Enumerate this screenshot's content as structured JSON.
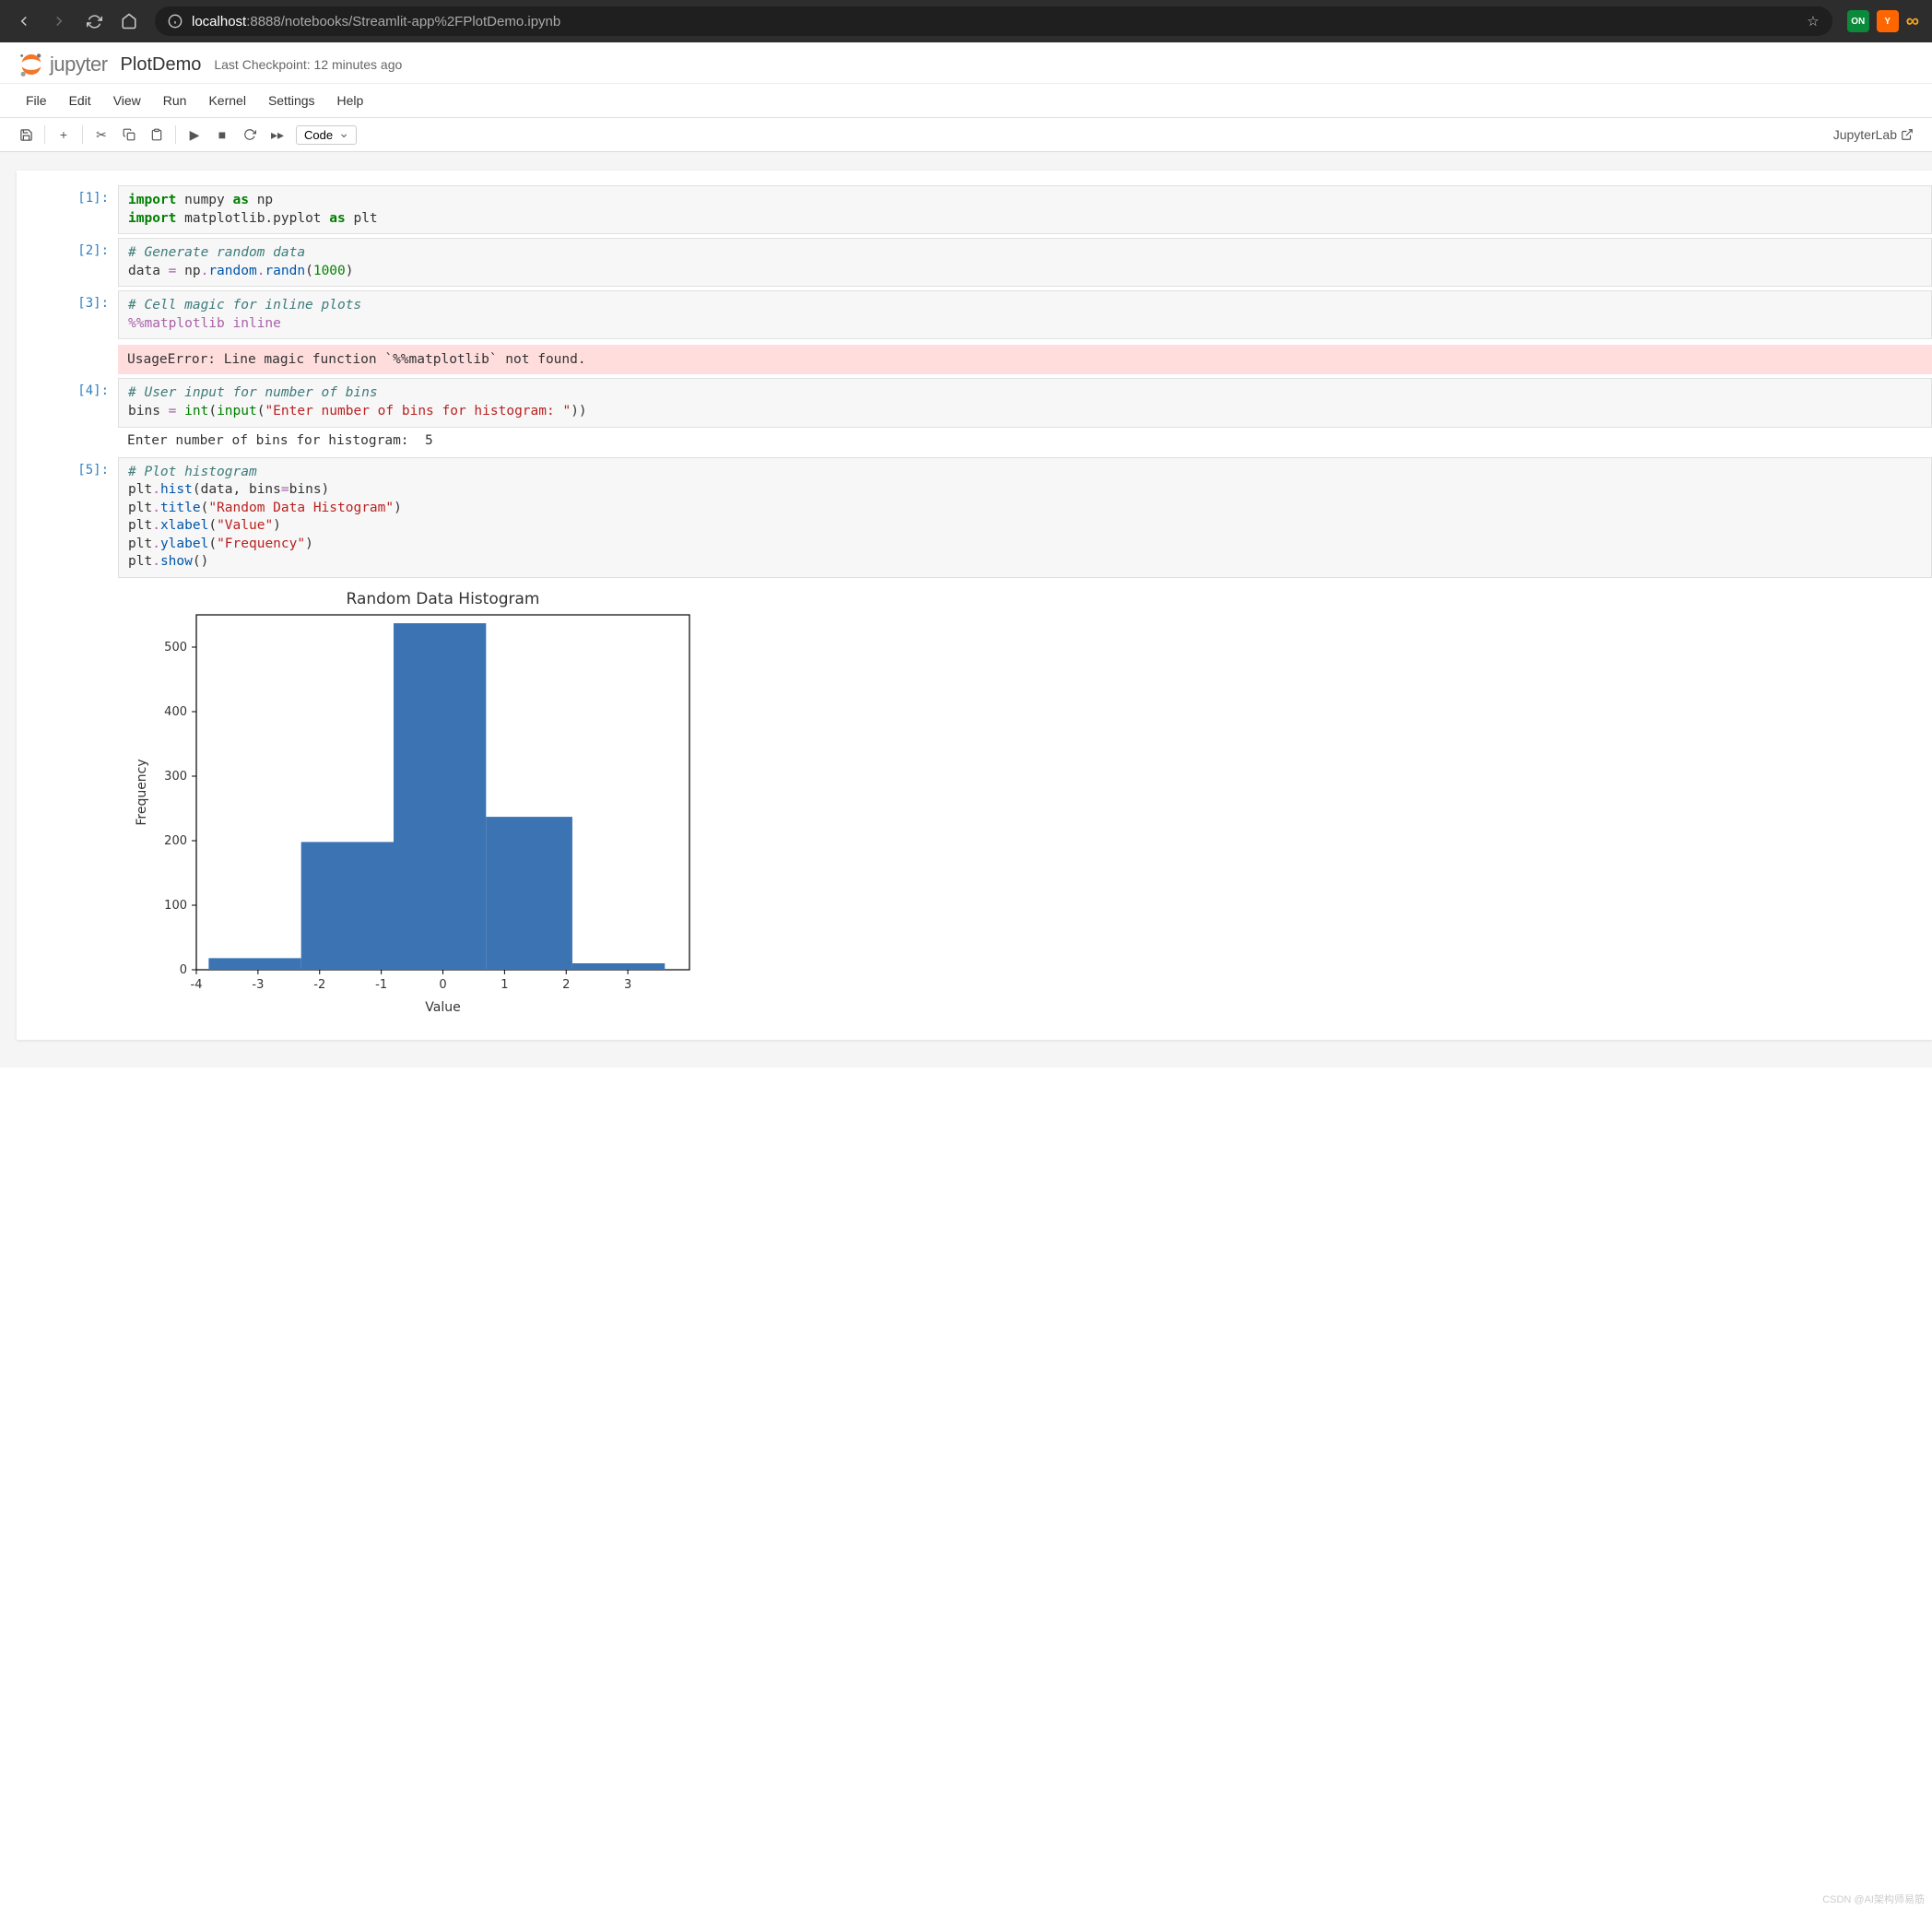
{
  "browser": {
    "url_host": "localhost",
    "url_port_path": ":8888/notebooks/Streamlit-app%2FPlotDemo.ipynb",
    "ext_on": "ON",
    "ext_y": "Y"
  },
  "header": {
    "brand": "jupyter",
    "title": "PlotDemo",
    "checkpoint": "Last Checkpoint: 12 minutes ago"
  },
  "menu": [
    "File",
    "Edit",
    "View",
    "Run",
    "Kernel",
    "Settings",
    "Help"
  ],
  "toolbar": {
    "celltype": "Code",
    "jl_link": "JupyterLab"
  },
  "cells": {
    "c1": {
      "prompt": "[1]:"
    },
    "c2": {
      "prompt": "[2]:"
    },
    "c3": {
      "prompt": "[3]:",
      "error": "UsageError: Line magic function `%%matplotlib` not found."
    },
    "c4": {
      "prompt": "[4]:",
      "output": "Enter number of bins for histogram:  5"
    },
    "c5": {
      "prompt": "[5]:"
    }
  },
  "code": {
    "c1_l1_kw1": "import",
    "c1_l1_name": " numpy ",
    "c1_l1_kw2": "as",
    "c1_l1_alias": " np",
    "c1_l2_kw1": "import",
    "c1_l2_name": " matplotlib.pyplot ",
    "c1_l2_kw2": "as",
    "c1_l2_alias": " plt",
    "c2_l1": "# Generate random data",
    "c2_l2_a": "data ",
    "c2_l2_op": "=",
    "c2_l2_b": " np",
    "c2_l2_d1": ".",
    "c2_l2_c": "random",
    "c2_l2_d2": ".",
    "c2_l2_d": "randn",
    "c2_l2_p1": "(",
    "c2_l2_num": "1000",
    "c2_l2_p2": ")",
    "c3_l1": "# Cell magic for inline plots",
    "c3_l2": "%%matplotlib inline",
    "c4_l1": "# User input for number of bins",
    "c4_l2_a": "bins ",
    "c4_l2_op": "=",
    "c4_l2_b": " ",
    "c4_l2_int": "int",
    "c4_l2_p1": "(",
    "c4_l2_input": "input",
    "c4_l2_p2": "(",
    "c4_l2_str": "\"Enter number of bins for histogram: \"",
    "c4_l2_p3": "))",
    "c5_l1": "# Plot histogram",
    "c5_l2_a": "plt",
    "c5_l2_d": ".",
    "c5_l2_f": "hist",
    "c5_l2_args": "(data, bins",
    "c5_l2_op": "=",
    "c5_l2_b": "bins)",
    "c5_l3_a": "plt",
    "c5_l3_d": ".",
    "c5_l3_f": "title",
    "c5_l3_p1": "(",
    "c5_l3_str": "\"Random Data Histogram\"",
    "c5_l3_p2": ")",
    "c5_l4_a": "plt",
    "c5_l4_d": ".",
    "c5_l4_f": "xlabel",
    "c5_l4_p1": "(",
    "c5_l4_str": "\"Value\"",
    "c5_l4_p2": ")",
    "c5_l5_a": "plt",
    "c5_l5_d": ".",
    "c5_l5_f": "ylabel",
    "c5_l5_p1": "(",
    "c5_l5_str": "\"Frequency\"",
    "c5_l5_p2": ")",
    "c5_l6_a": "plt",
    "c5_l6_d": ".",
    "c5_l6_f": "show",
    "c5_l6_p": "()"
  },
  "chart_data": {
    "type": "bar",
    "title": "Random Data Histogram",
    "xlabel": "Value",
    "ylabel": "Frequency",
    "xlim": [
      -4,
      4
    ],
    "ylim": [
      0,
      550
    ],
    "xticks": [
      -4,
      -3,
      -2,
      -1,
      0,
      1,
      2,
      3
    ],
    "yticks": [
      0,
      100,
      200,
      300,
      400,
      500
    ],
    "bin_edges": [
      -3.8,
      -2.3,
      -0.8,
      0.7,
      2.1,
      3.6
    ],
    "values": [
      18,
      198,
      537,
      237,
      10
    ]
  },
  "watermark": "CSDN @AI架构师易筋"
}
